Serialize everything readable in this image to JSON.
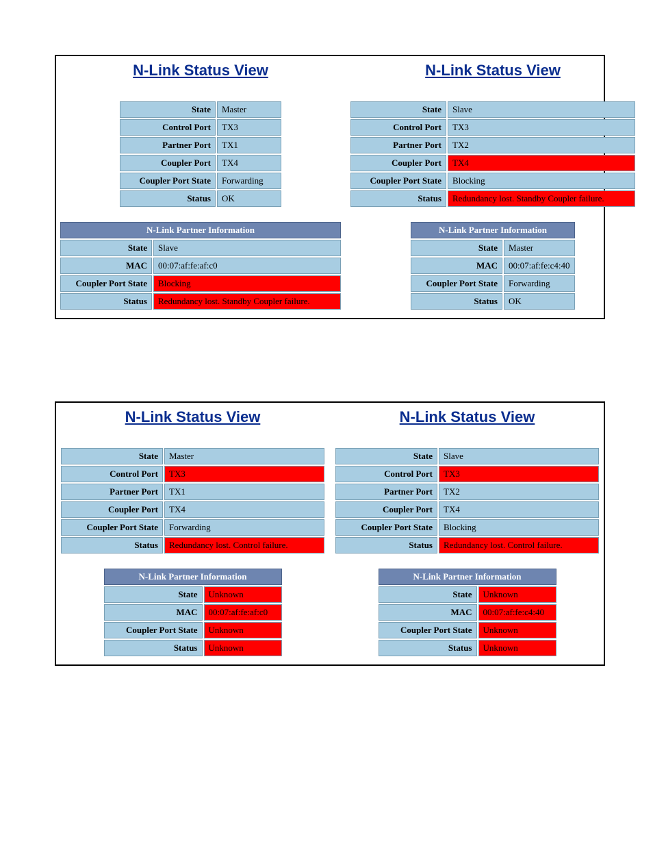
{
  "title": "N-Link Status View",
  "partner_header": "N-Link Partner Information",
  "labels": {
    "state": "State",
    "control_port": "Control Port",
    "partner_port": "Partner Port",
    "coupler_port": "Coupler Port",
    "coupler_port_state": "Coupler Port State",
    "status": "Status",
    "mac": "MAC"
  },
  "blocks": [
    {
      "panels": [
        {
          "main": [
            {
              "label": "state",
              "value": "Master",
              "error": false
            },
            {
              "label": "control_port",
              "value": "TX3",
              "error": false
            },
            {
              "label": "partner_port",
              "value": "TX1",
              "error": false
            },
            {
              "label": "coupler_port",
              "value": "TX4",
              "error": false
            },
            {
              "label": "coupler_port_state",
              "value": "Forwarding",
              "error": false
            },
            {
              "label": "status",
              "value": "OK",
              "error": false
            }
          ],
          "partner": [
            {
              "label": "state",
              "value": "Slave",
              "error": false
            },
            {
              "label": "mac",
              "value": "00:07:af:fe:af:c0",
              "error": false
            },
            {
              "label": "coupler_port_state",
              "value": "Blocking",
              "error": true
            },
            {
              "label": "status",
              "value": "Redundancy lost. Standby Coupler failure.",
              "error": true
            }
          ],
          "main_label_w": 126,
          "main_val_w": 80,
          "partner_label_w": 120,
          "partner_val_w": 260
        },
        {
          "main": [
            {
              "label": "state",
              "value": "Slave",
              "error": false
            },
            {
              "label": "control_port",
              "value": "TX3",
              "error": false
            },
            {
              "label": "partner_port",
              "value": "TX2",
              "error": false
            },
            {
              "label": "coupler_port",
              "value": "TX4",
              "error": true
            },
            {
              "label": "coupler_port_state",
              "value": "Blocking",
              "error": false
            },
            {
              "label": "status",
              "value": "Redundancy lost. Standby Coupler failure.",
              "error": true
            }
          ],
          "partner": [
            {
              "label": "state",
              "value": "Master",
              "error": false
            },
            {
              "label": "mac",
              "value": "00:07:af:fe:c4:40",
              "error": false
            },
            {
              "label": "coupler_port_state",
              "value": "Forwarding",
              "error": false
            },
            {
              "label": "status",
              "value": "OK",
              "error": false
            }
          ],
          "main_label_w": 126,
          "main_val_w": 260,
          "partner_label_w": 120,
          "partner_val_w": 90
        }
      ]
    },
    {
      "panels": [
        {
          "main": [
            {
              "label": "state",
              "value": "Master",
              "error": false
            },
            {
              "label": "control_port",
              "value": "TX3",
              "error": true
            },
            {
              "label": "partner_port",
              "value": "TX1",
              "error": false
            },
            {
              "label": "coupler_port",
              "value": "TX4",
              "error": false
            },
            {
              "label": "coupler_port_state",
              "value": "Forwarding",
              "error": false
            },
            {
              "label": "status",
              "value": "Redundancy lost. Control failure.",
              "error": true
            }
          ],
          "partner": [
            {
              "label": "state",
              "value": "Unknown",
              "error": true
            },
            {
              "label": "mac",
              "value": "00:07:af:fe:af:c0",
              "error": true
            },
            {
              "label": "coupler_port_state",
              "value": "Unknown",
              "error": true
            },
            {
              "label": "status",
              "value": "Unknown",
              "error": true
            }
          ],
          "main_label_w": 135,
          "main_val_w": 220,
          "partner_label_w": 130,
          "partner_val_w": 100
        },
        {
          "main": [
            {
              "label": "state",
              "value": "Slave",
              "error": false
            },
            {
              "label": "control_port",
              "value": "TX3",
              "error": true
            },
            {
              "label": "partner_port",
              "value": "TX2",
              "error": false
            },
            {
              "label": "coupler_port",
              "value": "TX4",
              "error": false
            },
            {
              "label": "coupler_port_state",
              "value": "Blocking",
              "error": false
            },
            {
              "label": "status",
              "value": "Redundancy lost. Control failure.",
              "error": true
            }
          ],
          "partner": [
            {
              "label": "state",
              "value": "Unknown",
              "error": true
            },
            {
              "label": "mac",
              "value": "00:07:af:fe:c4:40",
              "error": true
            },
            {
              "label": "coupler_port_state",
              "value": "Unknown",
              "error": true
            },
            {
              "label": "status",
              "value": "Unknown",
              "error": true
            }
          ],
          "main_label_w": 135,
          "main_val_w": 220,
          "partner_label_w": 130,
          "partner_val_w": 100
        }
      ]
    }
  ]
}
